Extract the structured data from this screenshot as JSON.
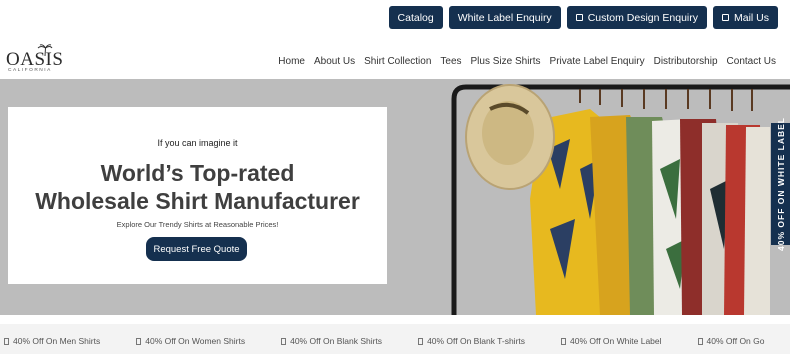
{
  "topbar": {
    "catalog": "Catalog",
    "white_label": "White Label Enquiry",
    "custom_design": "Custom Design Enquiry",
    "mail_us": "Mail Us"
  },
  "logo": {
    "word": "OASIS",
    "sub": "CALIFORNIA"
  },
  "nav": [
    "Home",
    "About Us",
    "Shirt Collection",
    "Tees",
    "Plus Size Shirts",
    "Private Label Enquiry",
    "Distributorship",
    "Contact Us"
  ],
  "hero": {
    "tagline": "If you can imagine it",
    "headline_line1": "World’s Top-rated",
    "headline_line2": "Wholesale Shirt Manufacturer",
    "subtext": "Explore Our Trendy Shirts at Reasonable Prices!",
    "cta": "Request Free Quote",
    "badge": "40% OFF ON WHITE LABEL"
  },
  "ticker": [
    "40% Off On Men Shirts",
    "40% Off On Women Shirts",
    "40% Off On Blank Shirts",
    "40% Off On Blank T-shirts",
    "40% Off On White Label",
    "40% Off On Go"
  ],
  "colors": {
    "brand_navy": "#15304f",
    "hero_bg": "#bcbcbc"
  }
}
